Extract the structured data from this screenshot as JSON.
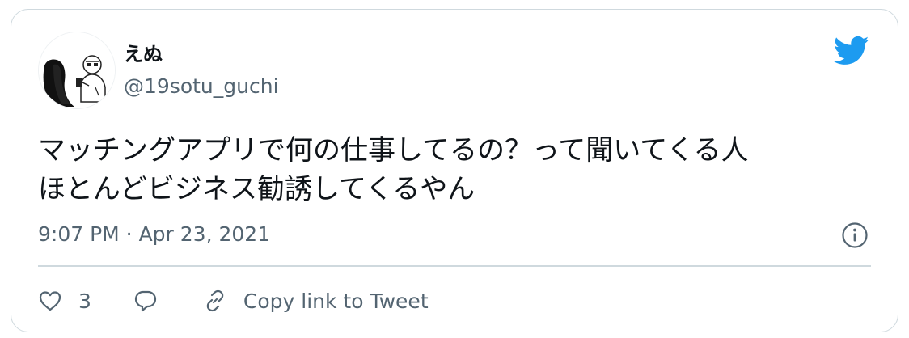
{
  "tweet": {
    "author_name": "えぬ",
    "author_handle": "@19sotu_guchi",
    "text_line1": "マッチングアプリで何の仕事してるの？って聞いてくる人",
    "text_line2": "ほとんどビジネス勧誘してくるやん",
    "timestamp": "9:07 PM · Apr 23, 2021"
  },
  "actions": {
    "like_count": "3",
    "copy_link_label": "Copy link to Tweet"
  },
  "icons": {
    "logo": "twitter-bird-icon",
    "info": "info-icon",
    "like": "heart-icon",
    "reply": "reply-bubble-icon",
    "link": "link-icon"
  },
  "colors": {
    "brand": "#1d9bf0",
    "text": "#0f1419",
    "secondary": "#536471",
    "border": "#cfd9de"
  }
}
